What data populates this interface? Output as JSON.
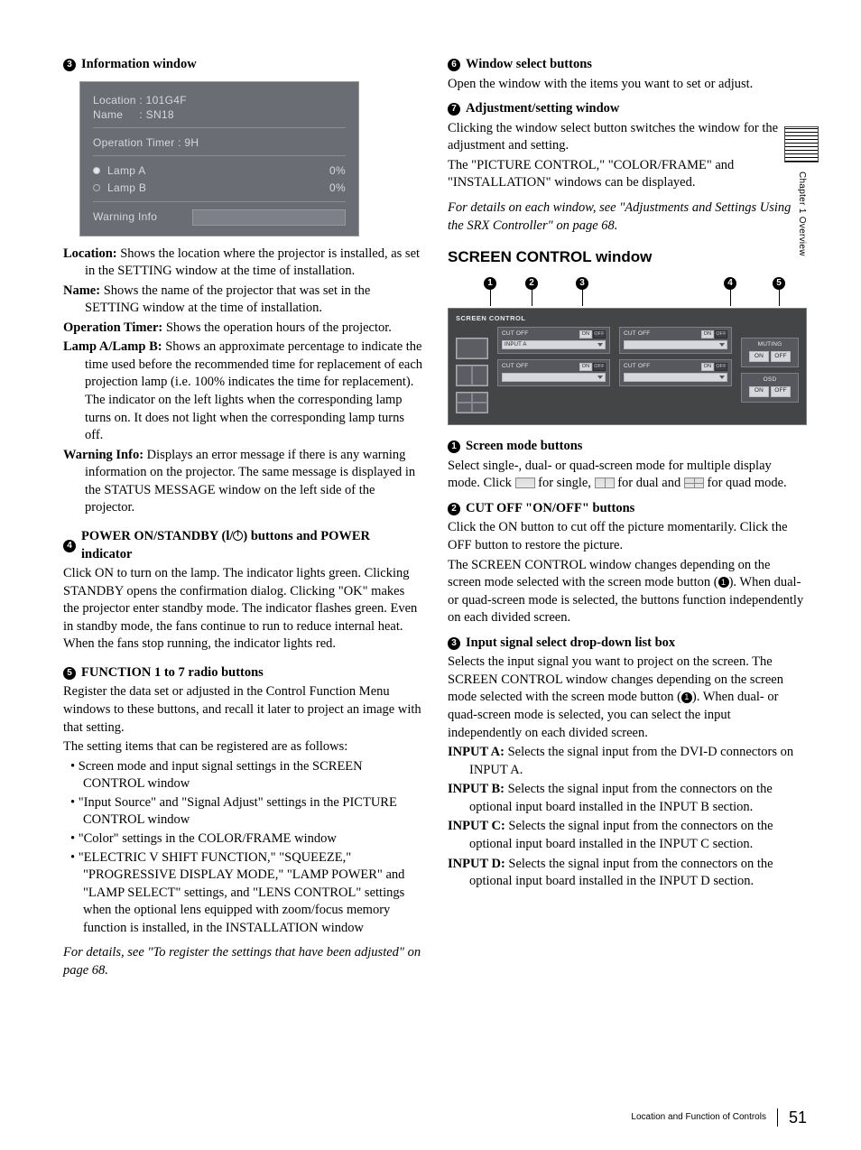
{
  "sideTab": {
    "label": "Chapter 1  Overview"
  },
  "footer": {
    "label": "Location and Function of Controls",
    "page": "51"
  },
  "left": {
    "s3": {
      "num": "3",
      "title": "Information window",
      "window": {
        "location": "Location : 101G4F",
        "name": "Name     : SN18",
        "timer": "Operation Timer : 9H",
        "lampA": "Lamp A",
        "lampB": "Lamp B",
        "pctA": "0%",
        "pctB": "0%",
        "warn": "Warning Info"
      },
      "defs": {
        "loc_t": "Location:",
        "loc_b": " Shows the location where the projector is installed, as set in the SETTING window at the time of installation.",
        "name_t": "Name:",
        "name_b": " Shows the name of the projector that was set in the SETTING window at the time of installation.",
        "op_t": "Operation Timer:",
        "op_b": " Shows the operation hours of the projector.",
        "lamp_t": "Lamp A/Lamp B:",
        "lamp_b": " Shows an approximate percentage to indicate the time used before the recommended time for replacement of each projection lamp (i.e. 100% indicates the time for replacement). The indicator on the left lights when the corresponding lamp turns on. It does not light when the corresponding lamp turns off.",
        "warn_t": "Warning Info:",
        "warn_b": " Displays an error message if there is any warning information on the projector. The same message is displayed in the STATUS MESSAGE window on the left side of the projector."
      }
    },
    "s4": {
      "num": "4",
      "title_a": "POWER ON/STANDBY (",
      "title_b": "/",
      "title_c": ") buttons and POWER indicator",
      "title_pre": "l",
      "body": "Click ON to turn on the lamp. The indicator lights green. Clicking STANDBY opens the confirmation dialog. Clicking \"OK\" makes the projector enter standby mode. The indicator flashes green. Even in standby mode, the fans continue to run to reduce internal heat. When the fans stop running, the indicator lights red."
    },
    "s5": {
      "num": "5",
      "title": "FUNCTION 1 to 7 radio buttons",
      "p1": "Register the data set or adjusted in the Control Function Menu windows to these buttons, and recall it later to project an image with that setting.",
      "p2": "The setting items that can be registered are as follows:",
      "b1": "Screen mode and input signal settings in the SCREEN CONTROL window",
      "b2": "\"Input Source\" and \"Signal Adjust\" settings in the PICTURE CONTROL window",
      "b3": "\"Color\" settings in the COLOR/FRAME window",
      "b4": "\"ELECTRIC V SHIFT FUNCTION,\" \"SQUEEZE,\" \"PROGRESSIVE DISPLAY MODE,\" \"LAMP POWER\" and \"LAMP SELECT\" settings, and \"LENS CONTROL\" settings when the optional lens equipped with zoom/focus memory function is installed, in the INSTALLATION window",
      "note": "For details, see \"To register the settings that have been adjusted\" on page 68."
    }
  },
  "right": {
    "s6": {
      "num": "6",
      "title": "Window select buttons",
      "body": "Open the window with the items you want to set or adjust."
    },
    "s7": {
      "num": "7",
      "title": "Adjustment/setting window",
      "p1": "Clicking the window select button switches the window for the adjustment and setting.",
      "p2": "The \"PICTURE CONTROL,\" \"COLOR/FRAME\" and \"INSTALLATION\" windows can be displayed.",
      "note": "For details on each window, see \"Adjustments and Settings Using the SRX Controller\" on page 68."
    },
    "scTitle": "SCREEN CONTROL window",
    "scw": {
      "title": "SCREEN CONTROL",
      "cutoff": "CUT OFF",
      "on": "ON",
      "off": "OFF",
      "inputA": "INPUT A",
      "muting": "MUTING",
      "osd": "OSD",
      "c1": "1",
      "c2": "2",
      "c3": "3",
      "c4": "4",
      "c5": "5"
    },
    "s1": {
      "num": "1",
      "title": "Screen mode buttons",
      "body_a": "Select single-, dual- or quad-screen mode for multiple display mode. Click ",
      "body_b": " for single, ",
      "body_c": " for dual and ",
      "body_d": " for quad mode."
    },
    "s2": {
      "num": "2",
      "title": "CUT OFF \"ON/OFF\" buttons",
      "p1": "Click the ON button to cut off the picture momentarily. Click the OFF button to restore the picture.",
      "p2a": "The SCREEN CONTROL window changes depending on the screen mode selected with the screen mode button (",
      "p2b": "). When dual- or quad-screen mode is selected, the buttons function independently on each divided screen.",
      "ref": "1"
    },
    "s3r": {
      "num": "3",
      "title": "Input signal select drop-down list box",
      "p1a": "Selects the input signal you want to project on the screen. The SCREEN CONTROL window changes depending on the screen mode selected with the screen mode button (",
      "p1b": "). When dual- or quad-screen mode is selected, you can select the input independently on each divided screen.",
      "ref": "1",
      "inA_t": "INPUT A:",
      "inA_b": " Selects the signal input from the DVI-D connectors on INPUT A.",
      "inB_t": "INPUT B:",
      "inB_b": " Selects the signal input from the connectors on the optional input board installed in the INPUT B section.",
      "inC_t": "INPUT C:",
      "inC_b": " Selects the signal input from the connectors on the optional input board installed in the INPUT C section.",
      "inD_t": "INPUT D:",
      "inD_b": " Selects the signal input from the connectors on the optional input board installed in the INPUT D section."
    }
  }
}
